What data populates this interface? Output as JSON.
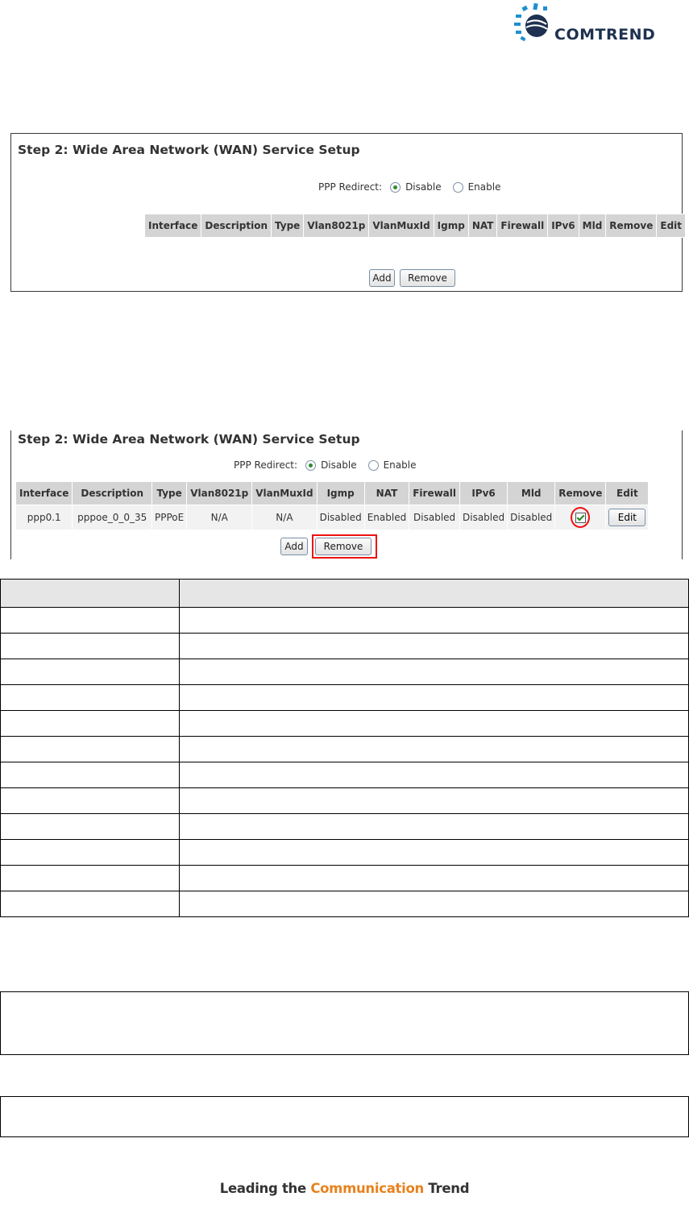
{
  "logo": {
    "text": "COMTREND"
  },
  "panel_empty": {
    "title": "Step 2: Wide Area Network (WAN) Service Setup",
    "ppp_redirect_label": "PPP Redirect:",
    "options": [
      "Disable",
      "Enable"
    ],
    "selected": "Disable",
    "columns": [
      "Interface",
      "Description",
      "Type",
      "Vlan8021p",
      "VlanMuxId",
      "Igmp",
      "NAT",
      "Firewall",
      "IPv6",
      "Mld",
      "Remove",
      "Edit"
    ],
    "add_label": "Add",
    "remove_label": "Remove"
  },
  "panel_filled": {
    "title": "Step 2: Wide Area Network (WAN) Service Setup",
    "ppp_redirect_label": "PPP Redirect:",
    "options": [
      "Disable",
      "Enable"
    ],
    "selected": "Disable",
    "columns": [
      "Interface",
      "Description",
      "Type",
      "Vlan8021p",
      "VlanMuxId",
      "Igmp",
      "NAT",
      "Firewall",
      "IPv6",
      "Mld",
      "Remove",
      "Edit"
    ],
    "row": {
      "interface": "ppp0.1",
      "description": "pppoe_0_0_35",
      "type": "PPPoE",
      "vlan8021p": "N/A",
      "vlanmuxid": "N/A",
      "igmp": "Disabled",
      "nat": "Enabled",
      "firewall": "Disabled",
      "ipv6": "Disabled",
      "mld": "Disabled",
      "remove_checked": true,
      "edit_label": "Edit"
    },
    "add_label": "Add",
    "remove_label": "Remove"
  },
  "footer": {
    "pre": "Leading the ",
    "highlight": "Communication",
    "post": " Trend"
  },
  "colors": {
    "highlight_red": "#ee1111",
    "footer_orange": "#e8821e",
    "header_gray": "#d4d4d4",
    "cell_gray": "#f2f2f2"
  }
}
